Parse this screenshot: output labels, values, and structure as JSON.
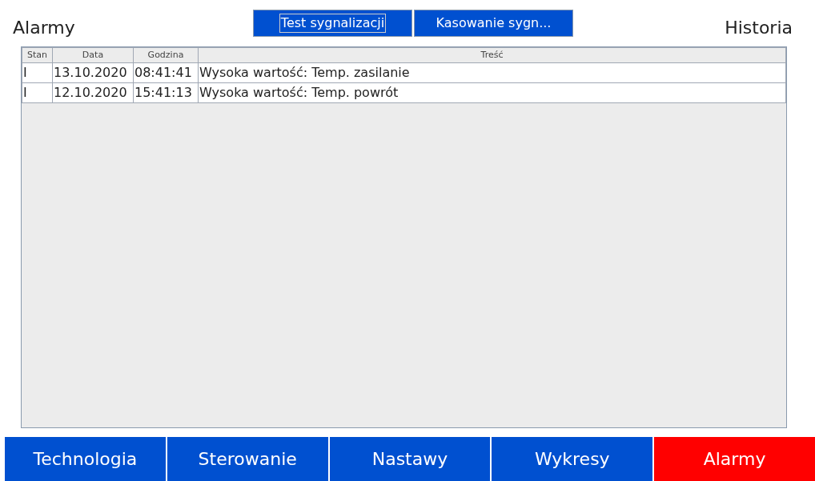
{
  "header": {
    "title": "Alarmy",
    "history": "Historia"
  },
  "buttons": [
    {
      "label": "Test sygnalizacji",
      "focused": true
    },
    {
      "label": "Kasowanie sygn...",
      "focused": false
    }
  ],
  "table": {
    "columns": [
      "Stan",
      "Data",
      "Godzina",
      "Treść"
    ],
    "rows": [
      [
        "I",
        "13.10.2020",
        "08:41:41",
        "Wysoka wartość: Temp. zasilanie"
      ],
      [
        "I",
        "12.10.2020",
        "15:41:13",
        "Wysoka wartość: Temp. powrót"
      ]
    ]
  },
  "nav": [
    {
      "label": "Technologia",
      "selected": false
    },
    {
      "label": "Sterowanie",
      "selected": false
    },
    {
      "label": "Nastawy",
      "selected": false
    },
    {
      "label": "Wykresy",
      "selected": false
    },
    {
      "label": "Alarmy",
      "selected": true
    }
  ]
}
